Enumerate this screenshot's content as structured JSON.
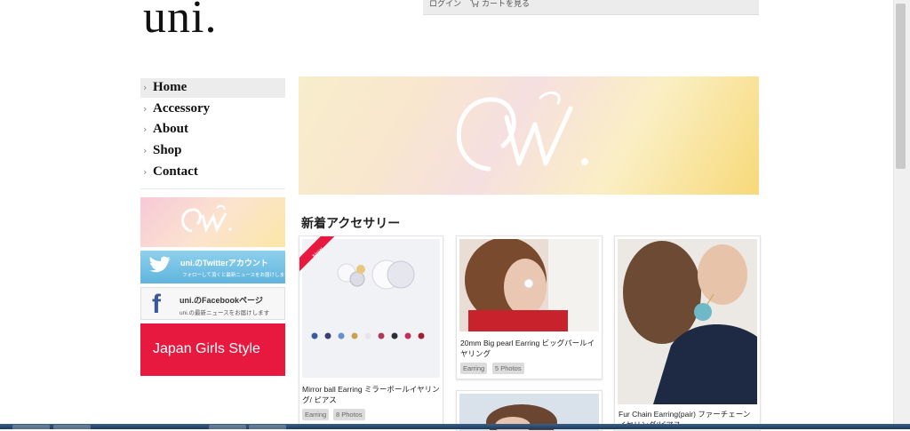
{
  "header": {
    "logo": "uni.",
    "login_label": "ログイン",
    "cart_label": "カートを見る"
  },
  "nav": [
    {
      "label": "Home",
      "active": true
    },
    {
      "label": "Accessory",
      "active": false
    },
    {
      "label": "About",
      "active": false
    },
    {
      "label": "Shop",
      "active": false
    },
    {
      "label": "Contact",
      "active": false
    }
  ],
  "sidebar": {
    "twitter": {
      "title": "uni.のTwitterアカウント",
      "subtitle": "フォローして頂くと最新ニュースをお届けします"
    },
    "facebook": {
      "title": "uni.のFacebookページ",
      "subtitle": "uni.の最新ニュースをお届けします"
    },
    "jgs": {
      "label": "Japan Girls Style"
    }
  },
  "main": {
    "section_title": "新着アクセサリー",
    "new_badge": "New",
    "products": [
      {
        "title": "Mirror ball Earring ミラーボールイヤリング/ ピアス",
        "tags": [
          "Earring",
          "8 Photos"
        ]
      },
      {
        "title": "20mm Big pearl Earring ビッグパールイヤリング",
        "tags": [
          "Earring",
          "5 Photos"
        ]
      },
      {
        "title": "Fur Chain Earring(pair) ファーチェーン イヤリング/ピアス",
        "tags": []
      }
    ]
  },
  "colors": {
    "accent_red": "#e8193f",
    "twitter_blue": "#5fb4de",
    "facebook_blue": "#3b5998"
  }
}
